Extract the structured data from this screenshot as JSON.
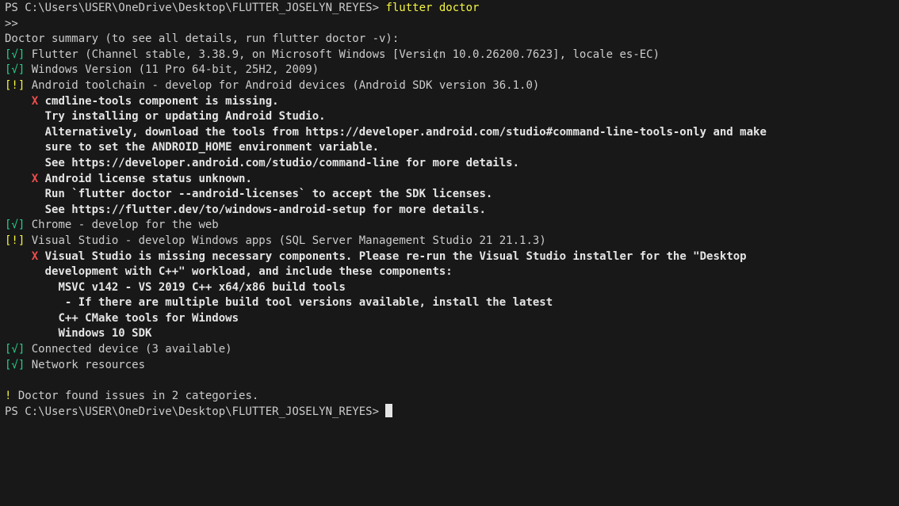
{
  "terminal": {
    "prompt": "PS C:\\Users\\USER\\OneDrive\\Desktop\\FLUTTER_JOSELYN_REYES> ",
    "command": "flutter doctor",
    "continuation": ">>",
    "summary": "Doctor summary (to see all details, run flutter doctor -v):",
    "ok_mark": "[√]",
    "warn_mark": "[!]",
    "err_mark": "X",
    "checks": {
      "flutter": "Flutter (Channel stable, 3.38.9, on Microsoft Windows [Versi¢n 10.0.26200.7623], locale es-EC)",
      "windows": "Windows Version (11 Pro 64-bit, 25H2, 2009)",
      "android": "Android toolchain - develop for Android devices (Android SDK version 36.1.0)",
      "chrome": "Chrome - develop for the web",
      "vs": "Visual Studio - develop Windows apps (SQL Server Management Studio 21 21.1.3)",
      "device": "Connected device (3 available)",
      "network": "Network resources"
    },
    "android_issues": {
      "cmdline_title": "cmdline-tools component is missing.",
      "cmdline_1": "Try installing or updating Android Studio.",
      "cmdline_2": "Alternatively, download the tools from https://developer.android.com/studio#command-line-tools-only and make",
      "cmdline_3": "sure to set the ANDROID_HOME environment variable.",
      "cmdline_4": "See https://developer.android.com/studio/command-line for more details.",
      "license_title": "Android license status unknown.",
      "license_1": "Run `flutter doctor --android-licenses` to accept the SDK licenses.",
      "license_2": "See https://flutter.dev/to/windows-android-setup for more details."
    },
    "vs_issues": {
      "title": "Visual Studio is missing necessary components. Please re-run the Visual Studio installer for the \"Desktop",
      "line_1": "development with C++\" workload, and include these components:",
      "comp_1": "MSVC v142 - VS 2019 C++ x64/x86 build tools",
      "comp_1_note": " - If there are multiple build tool versions available, install the latest",
      "comp_2": "C++ CMake tools for Windows",
      "comp_3": "Windows 10 SDK"
    },
    "footer_mark": "!",
    "footer": " Doctor found issues in 2 categories.",
    "final_prompt": "PS C:\\Users\\USER\\OneDrive\\Desktop\\FLUTTER_JOSELYN_REYES> "
  }
}
